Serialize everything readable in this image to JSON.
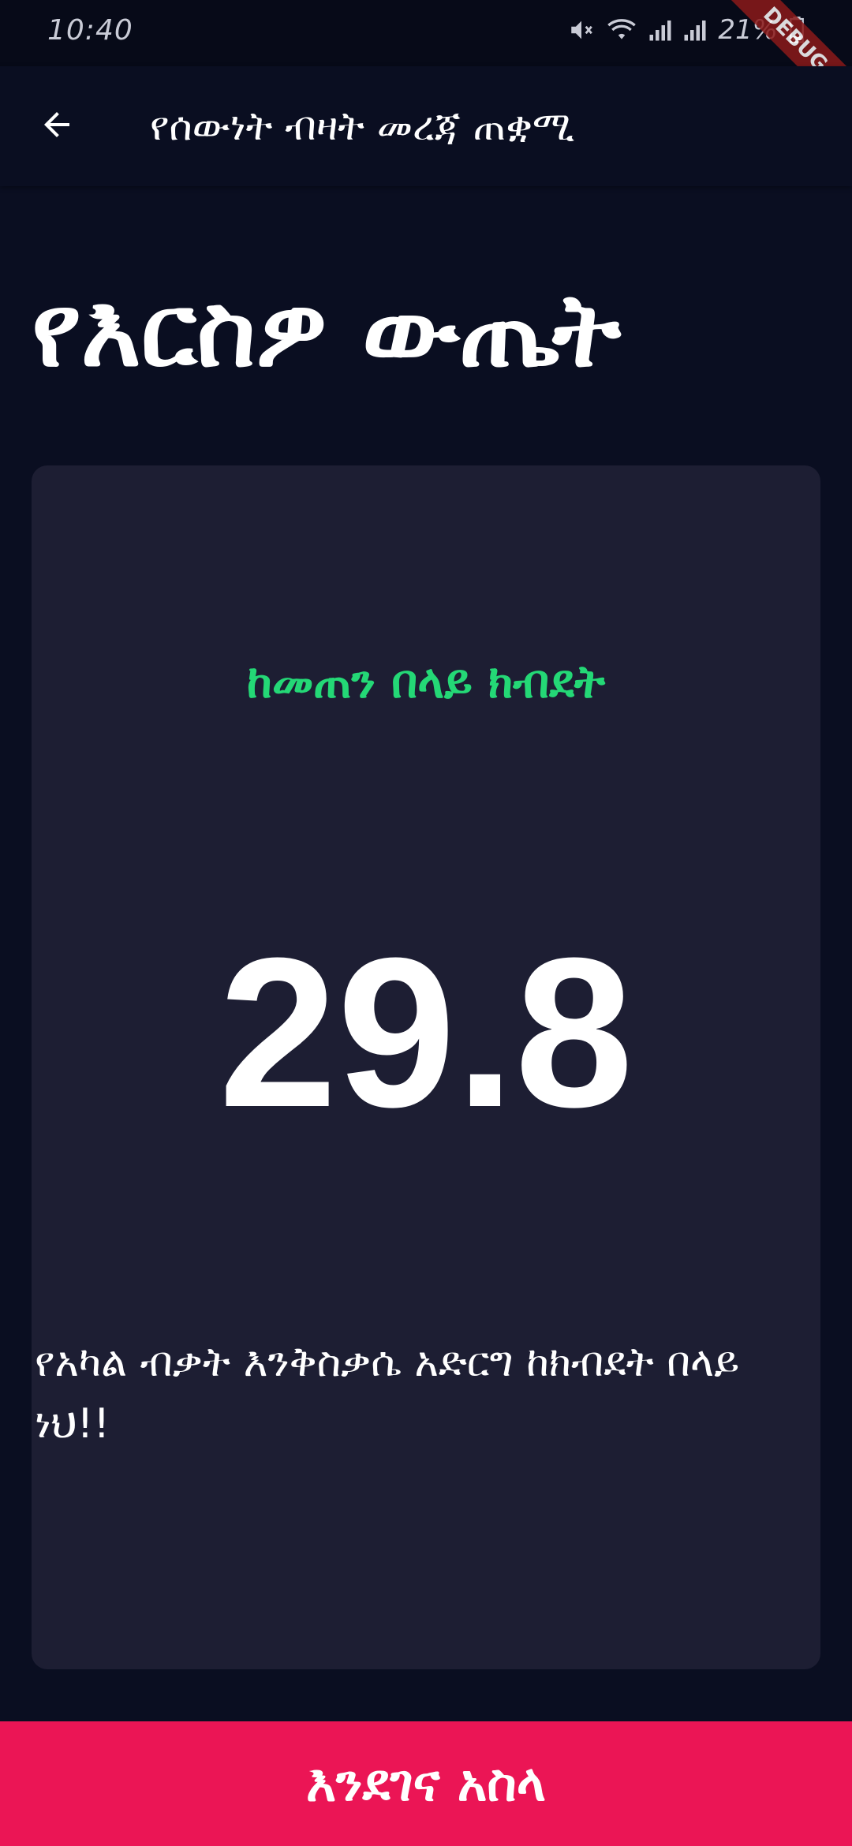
{
  "status_bar": {
    "time": "10:40",
    "battery": "21%",
    "icons": [
      "mute-icon",
      "wifi-icon",
      "signal-icon",
      "signal-icon",
      "battery-icon"
    ]
  },
  "debug_banner": "DEBUG",
  "app_bar": {
    "back_icon": "arrow-back-icon",
    "title": "የሰውነት ብዛት መረጃ ጠቋሚ"
  },
  "result": {
    "heading": "የእርስዎ ውጤት",
    "status": "ከመጠን በላይ ክብደት",
    "bmi": "29.8",
    "advice": "የአካል ብቃት እንቅስቃሴ አድርግ ከክብደት በላይ ነህ!!"
  },
  "recalculate_button": {
    "label": "እንደገና አስላ"
  },
  "colors": {
    "background": "#0a0e21",
    "card": "#1d1e33",
    "status_green": "#24d876",
    "button_pink": "#eb1555"
  }
}
